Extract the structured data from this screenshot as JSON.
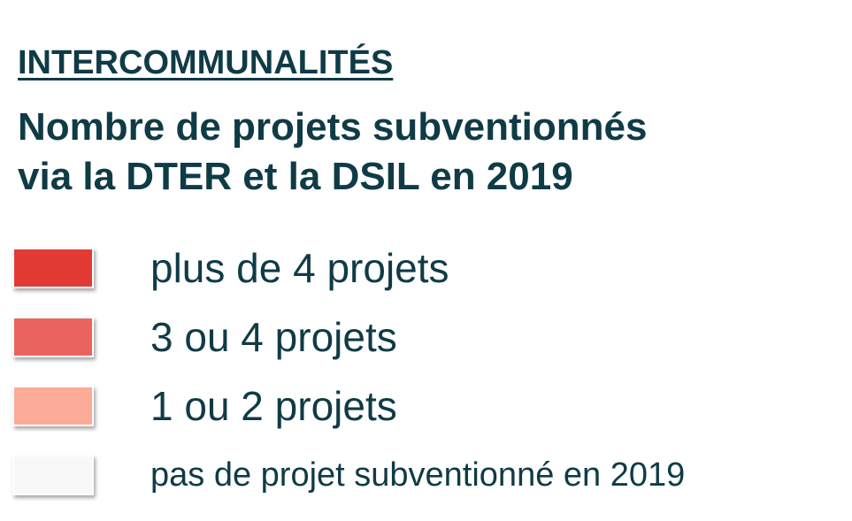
{
  "legend": {
    "category": "INTERCOMMUNALITÉS",
    "title_lines": [
      "Nombre de projets subventionnés",
      "via la DTER et la DSIL en 2019"
    ],
    "items": [
      {
        "label": "plus de 4 projets",
        "color": "#e13b34"
      },
      {
        "label": "3 ou 4 projets",
        "color": "#e8645c"
      },
      {
        "label": "1 ou 2 projets",
        "color": "#fcab98"
      },
      {
        "label": "pas de projet subventionné en 2019",
        "color": "#f8f8f8"
      }
    ]
  }
}
